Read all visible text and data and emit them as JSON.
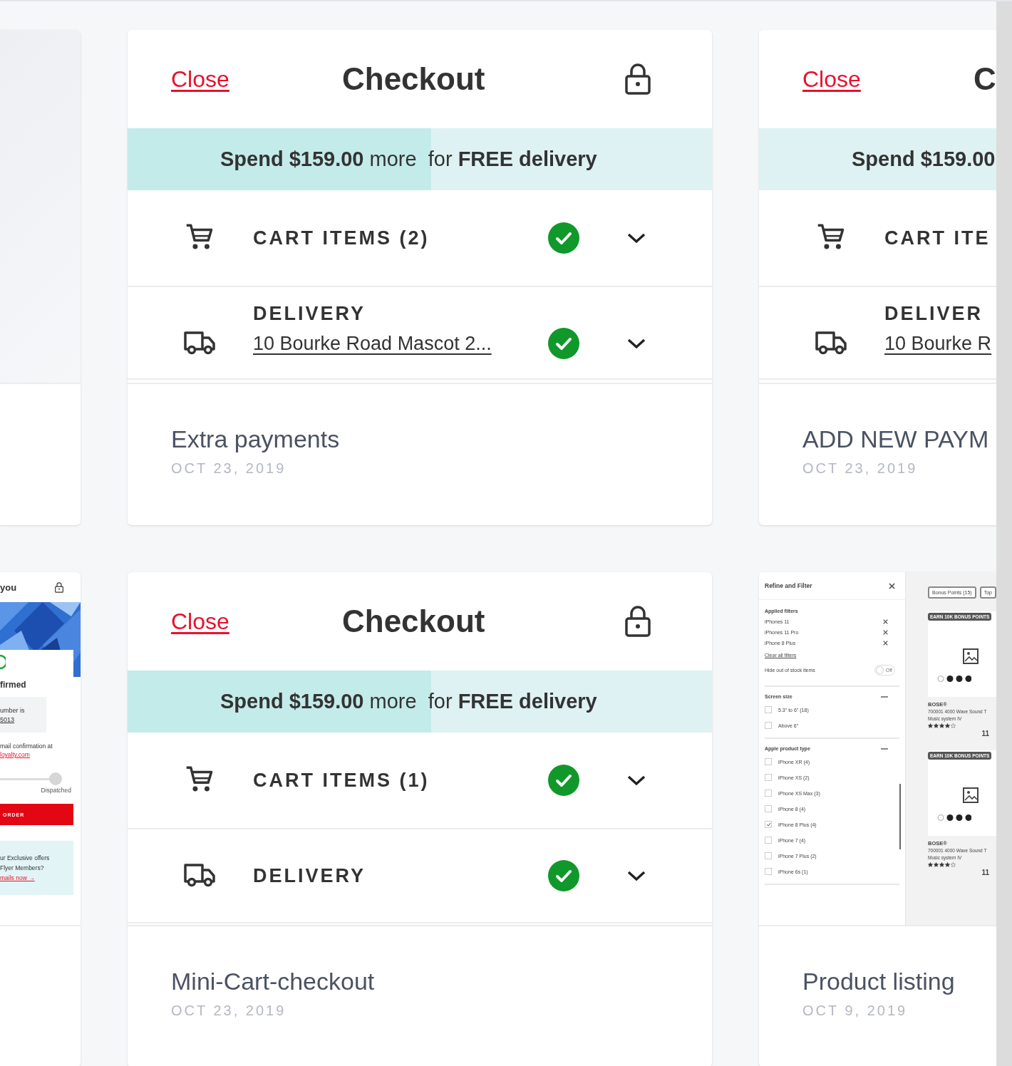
{
  "rows": [
    {
      "cards": [
        {
          "thumbnail": {
            "kind": "blank"
          }
        },
        {
          "thumbnail": {
            "kind": "checkout",
            "close": "Close",
            "title": "Checkout",
            "locked": true,
            "banner": {
              "text": "**Spend $159.00** more  for **FREE delivery**",
              "level": 0.52
            },
            "sections": [
              {
                "kind": "cart",
                "label": "CART ITEMS (2)",
                "complete": true,
                "expandable": true
              },
              {
                "kind": "delivery",
                "label": "DELIVERY",
                "address": "10 Bourke Road Mascot 2...",
                "complete": true,
                "expandable": true
              }
            ]
          },
          "title": "Extra payments",
          "date": "OCT 23, 2019"
        },
        {
          "thumbnail": {
            "kind": "checkout",
            "close": "Close",
            "title": "C",
            "banner": {
              "text": "**Spend $159.00**"
            },
            "sections": [
              {
                "kind": "cart",
                "label": "CART ITE"
              },
              {
                "kind": "delivery",
                "label": "DELIVER",
                "address": "10 Bourke R"
              }
            ]
          },
          "title": "ADD NEW PAYM",
          "date": "OCT 23, 2019"
        }
      ]
    },
    {
      "cards": [
        {
          "thumbnail": {
            "kind": "confirmation",
            "heading": "you",
            "status": "firmed",
            "order_label": "umber is",
            "order_number": "5013",
            "email_note": "mail confirmation at",
            "email": "loyalty.com",
            "progress_label": "Dispatched",
            "button": "ORDER",
            "offer_lines": [
              "ur Exclusive offers",
              "Flyer Members?"
            ],
            "offer_link": "mails now →"
          }
        },
        {
          "thumbnail": {
            "kind": "checkout",
            "close": "Close",
            "title": "Checkout",
            "locked": true,
            "banner": {
              "text": "**Spend $159.00** more  for **FREE delivery**",
              "level": 0.52
            },
            "sections": [
              {
                "kind": "cart",
                "label": "CART ITEMS (1)",
                "complete": true,
                "expandable": true
              },
              {
                "kind": "delivery",
                "label": "DELIVERY",
                "complete": true,
                "expandable": true
              }
            ]
          },
          "title": "Mini-Cart-checkout",
          "date": "OCT 23, 2019"
        },
        {
          "thumbnail": {
            "kind": "listing",
            "filter": {
              "title": "Refine and Filter",
              "applied_title": "Applied filters",
              "applied": [
                "iPhones 11",
                "iPhones 11 Pro",
                "iPhone 8 Plus"
              ],
              "clear": "Clear all filters",
              "toggle": {
                "label": "Hide out of stock items",
                "state": "Off",
                "on": false
              },
              "groups": [
                {
                  "title": "Screen size",
                  "options": [
                    {
                      "label": "5.3\" to 6\" (18)",
                      "checked": false
                    },
                    {
                      "label": "Above 6\"",
                      "checked": false
                    }
                  ]
                },
                {
                  "title": "Apple product type",
                  "options": [
                    {
                      "label": "iPhone XR (4)",
                      "checked": false
                    },
                    {
                      "label": "iPhone XS (2)",
                      "checked": false
                    },
                    {
                      "label": "iPhone XS Max (3)",
                      "checked": false
                    },
                    {
                      "label": "iPhone 8 (4)",
                      "checked": false
                    },
                    {
                      "label": "iPhone 8 Plus (4)",
                      "checked": true
                    },
                    {
                      "label": "iPhone 7 (4)",
                      "checked": false
                    },
                    {
                      "label": "iPhone 7 Plus (2)",
                      "checked": false
                    },
                    {
                      "label": "iPhone 6s (1)",
                      "checked": false
                    }
                  ]
                }
              ]
            },
            "chips": [
              "Bonus Points (15)",
              "Top"
            ],
            "products": [
              {
                "badge": "EARN 10K BONUS POINTS",
                "brand": "BOSE®",
                "name": "700001 4000 Wave Sound T",
                "name2": "Music system IV",
                "stars": 4,
                "price": "11"
              },
              {
                "badge": "EARN 10K BONUS POINTS",
                "brand": "BOSE®",
                "name": "700001 4000 Wave Sound T",
                "name2": "Music system IV",
                "stars": 4,
                "price": "11"
              }
            ]
          },
          "title": "Product listing",
          "date": "OCT 9, 2019"
        }
      ]
    }
  ]
}
